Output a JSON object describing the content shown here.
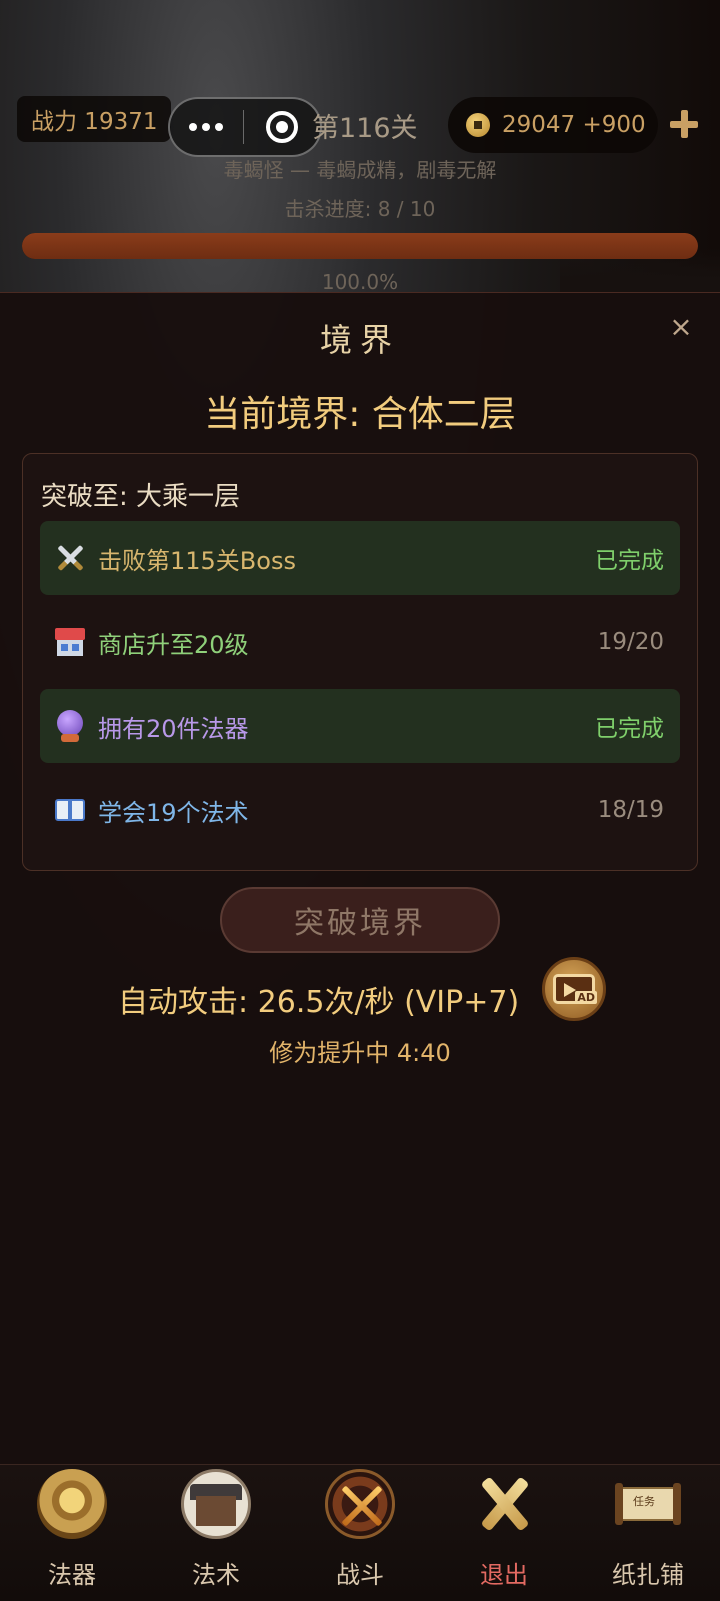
{
  "hud": {
    "power": "战力 19371",
    "level": "第116关",
    "coins": "29047 +900",
    "monster": "毒蝎怪 — 毒蝎成精，剧毒无解",
    "kill_progress": "击杀进度: 8 / 10",
    "hp_fraction": 1.0,
    "hp_percent_text": "100.0%"
  },
  "panel": {
    "title": "境界",
    "close_glyph": "×",
    "current_realm": "当前境界: 合体二层",
    "breakthrough_target": "突破至: 大乘一层",
    "requirements": [
      {
        "icon": "crossed-swords-icon",
        "label": "击败第115关Boss",
        "status": "已完成",
        "done": true,
        "label_color": "#d8b66e"
      },
      {
        "icon": "shop-icon",
        "label": "商店升至20级",
        "status": "19/20",
        "done": false,
        "label_color": "#8fd07a"
      },
      {
        "icon": "crystal-ball-icon",
        "label": "拥有20件法器",
        "status": "已完成",
        "done": true,
        "label_color": "#b898e8"
      },
      {
        "icon": "book-icon",
        "label": "学会19个法术",
        "status": "18/19",
        "done": false,
        "label_color": "#7fb6e8"
      }
    ],
    "break_button": "突破境界",
    "auto_attack": "自动攻击: 26.5次/秒 (VIP+7)",
    "ad_badge": "AD",
    "cultivation": "修为提升中 4:40"
  },
  "nav": [
    {
      "label": "法器",
      "icon": "artifact-icon"
    },
    {
      "label": "法术",
      "icon": "spell-hall-icon"
    },
    {
      "label": "战斗",
      "icon": "battle-icon"
    },
    {
      "label": "退出",
      "icon": "exit-icon"
    },
    {
      "label": "纸扎铺",
      "icon": "scroll-shop-icon"
    }
  ],
  "scroll_text": "任务"
}
